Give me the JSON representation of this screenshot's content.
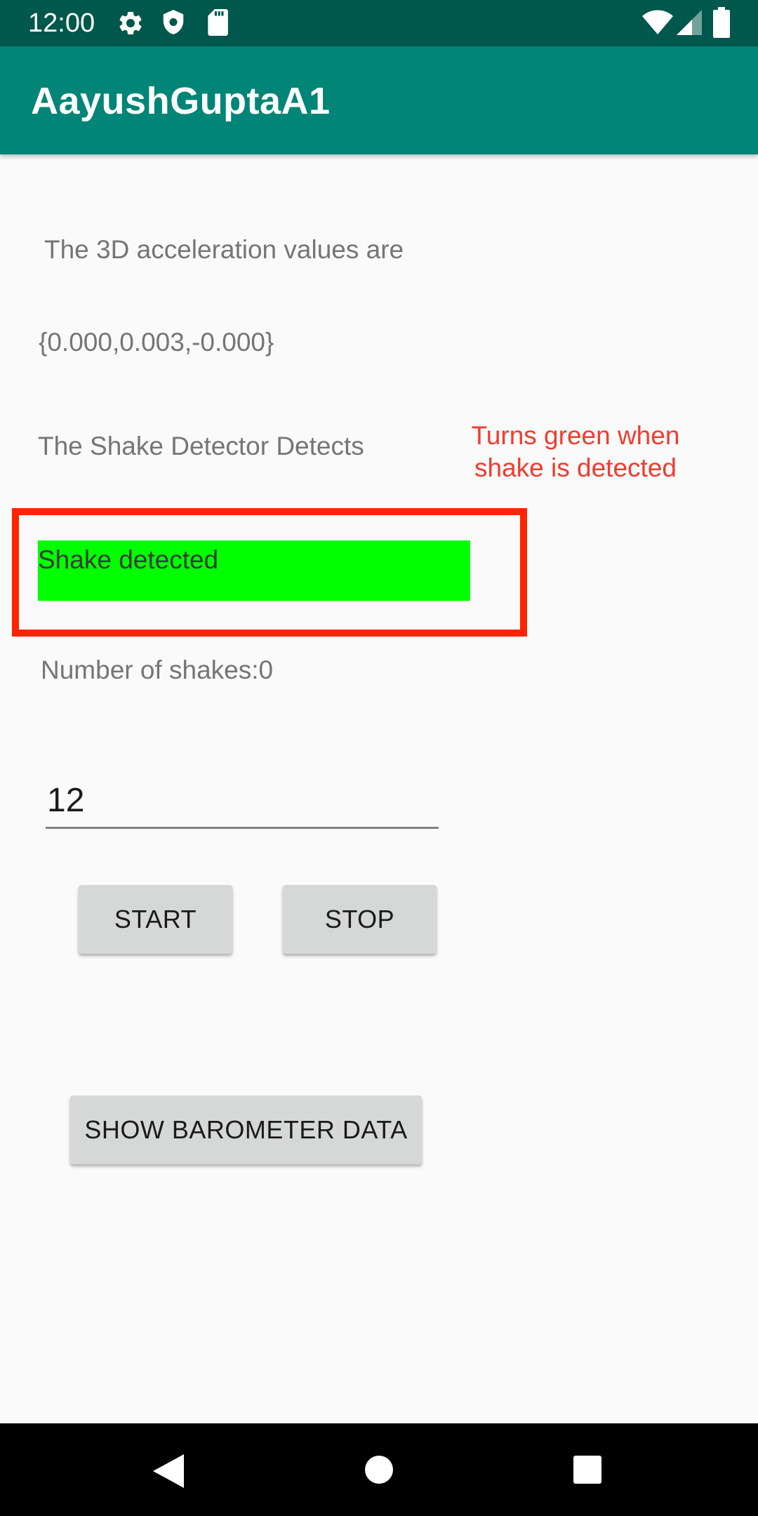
{
  "status_bar": {
    "time": "12:00",
    "left_icons": [
      "gear-icon",
      "shield-icon",
      "sd-card-icon"
    ],
    "right_icons": [
      "wifi-icon",
      "signal-icon",
      "battery-icon"
    ],
    "background": "#00574b"
  },
  "app_bar": {
    "title": "AayushGuptaA1",
    "background": "#008577"
  },
  "main": {
    "acceleration_heading": "The 3D acceleration values are",
    "acceleration_values": "{0.000,0.003,-0.000}",
    "detector_heading": "The Shake Detector Detects",
    "shake_status": {
      "label": "Shake detected",
      "color": "#00ff00"
    },
    "annotation": {
      "line1": "Turns green when",
      "line2": "shake is detected",
      "color": "#f23b2f",
      "box_color": "#ff2400"
    },
    "shake_count": "Number of shakes:0",
    "threshold_input": {
      "value": "12"
    },
    "buttons": {
      "start": "START",
      "stop": "STOP",
      "barometer": "SHOW BAROMETER DATA"
    }
  },
  "nav_bar": {
    "icons": [
      "back-icon",
      "home-icon",
      "recents-icon"
    ]
  }
}
